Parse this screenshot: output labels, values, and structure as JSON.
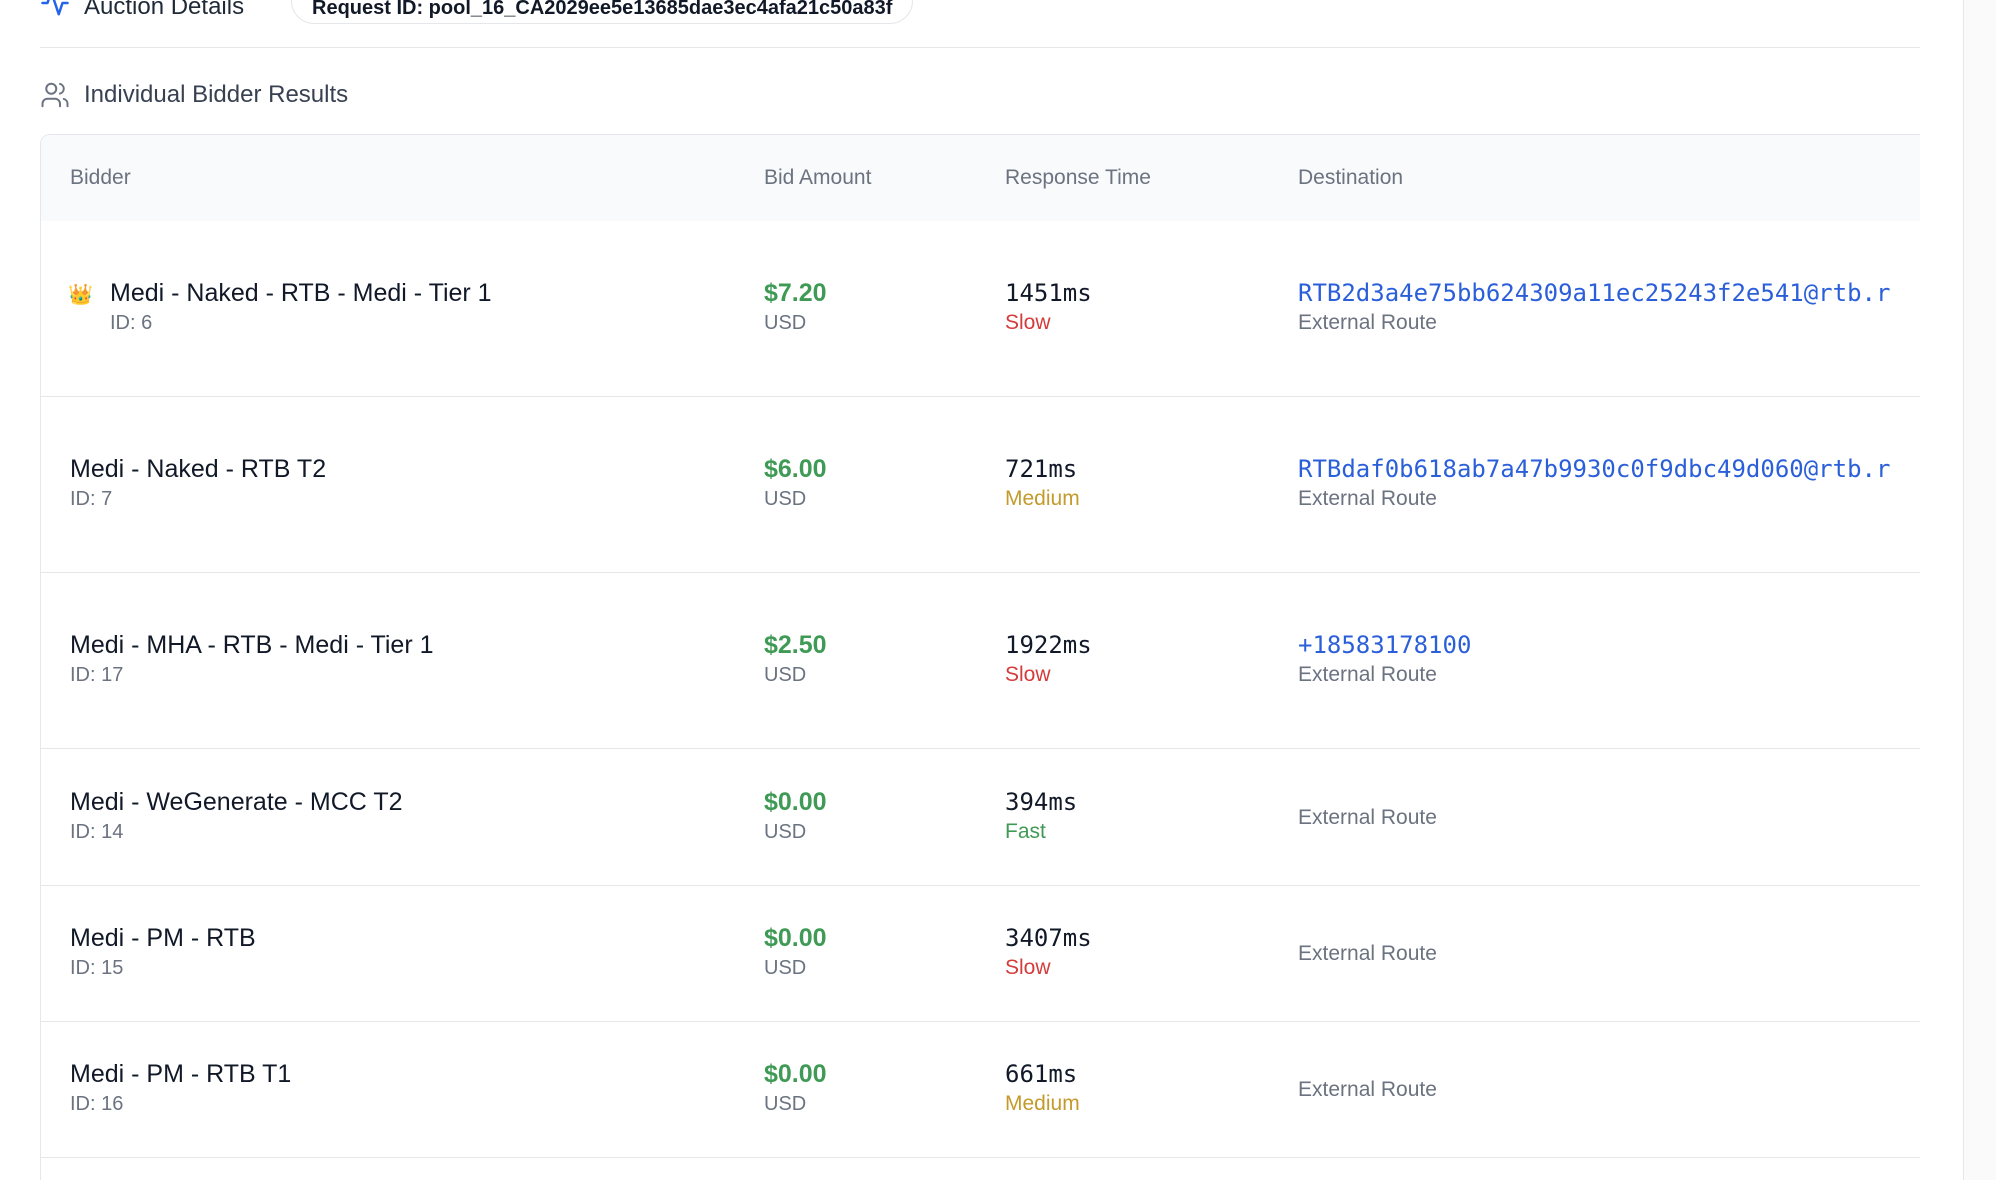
{
  "header": {
    "title": "Auction Details",
    "request_id": "Request ID: pool_16_CA2029ee5e13685dae3ec4afa21c50a83f"
  },
  "section": {
    "title": "Individual Bidder Results",
    "icon": "users-icon"
  },
  "table": {
    "columns": [
      "Bidder",
      "Bid Amount",
      "Response Time",
      "Destination"
    ],
    "rows": [
      {
        "name": "Medi - Naked - RTB - Medi - Tier 1",
        "id": "ID: 6",
        "winner": true,
        "winner_icon": "👑",
        "bid": "$7.20",
        "currency": "USD",
        "response": "1451ms",
        "speed": "Slow",
        "destination": "RTB2d3a4e75bb624309a11ec25243f2e541@rtb.r",
        "route": "External Route"
      },
      {
        "name": "Medi - Naked - RTB T2",
        "id": "ID: 7",
        "winner": false,
        "winner_icon": "",
        "bid": "$6.00",
        "currency": "USD",
        "response": "721ms",
        "speed": "Medium",
        "destination": "RTBdaf0b618ab7a47b9930c0f9dbc49d060@rtb.r",
        "route": "External Route"
      },
      {
        "name": "Medi - MHA - RTB - Medi - Tier 1",
        "id": "ID: 17",
        "winner": false,
        "winner_icon": "",
        "bid": "$2.50",
        "currency": "USD",
        "response": "1922ms",
        "speed": "Slow",
        "destination": "+18583178100",
        "route": "External Route"
      },
      {
        "name": "Medi - WeGenerate - MCC T2",
        "id": "ID: 14",
        "winner": false,
        "winner_icon": "",
        "bid": "$0.00",
        "currency": "USD",
        "response": "394ms",
        "speed": "Fast",
        "destination": "",
        "route": "External Route"
      },
      {
        "name": "Medi - PM - RTB",
        "id": "ID: 15",
        "winner": false,
        "winner_icon": "",
        "bid": "$0.00",
        "currency": "USD",
        "response": "3407ms",
        "speed": "Slow",
        "destination": "",
        "route": "External Route"
      },
      {
        "name": "Medi - PM - RTB T1",
        "id": "ID: 16",
        "winner": false,
        "winner_icon": "",
        "bid": "$0.00",
        "currency": "USD",
        "response": "661ms",
        "speed": "Medium",
        "destination": "",
        "route": "External Route"
      }
    ]
  },
  "colors": {
    "bid_green": "#3f9a55",
    "slow": "#d63b3b",
    "medium": "#c49a2c",
    "fast": "#3f9a55",
    "link": "#2b5fd9",
    "accent": "#2563eb"
  }
}
